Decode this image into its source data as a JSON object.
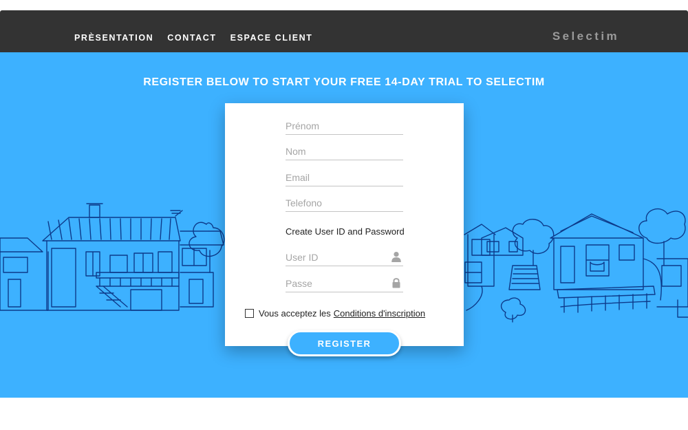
{
  "nav": {
    "links": [
      "PRÈSENTATION",
      "CONTACT",
      "ESPACE CLIENT"
    ],
    "brand": "Selectim"
  },
  "hero": {
    "title": "REGISTER BELOW TO START YOUR FREE 14-DAY TRIAL TO SELECTIM"
  },
  "form": {
    "prenom_placeholder": "Prénom",
    "nom_placeholder": "Nom",
    "email_placeholder": "Email",
    "telefono_placeholder": "Telefono",
    "create_label": "Create User ID and Password",
    "userid_placeholder": "User ID",
    "passe_placeholder": "Passe",
    "terms_text": "Vous acceptez les",
    "terms_link": "Conditions d'inscription",
    "register_label": "REGISTER"
  },
  "colors": {
    "navbar": "#333333",
    "hero_background": "#3db1ff",
    "sketch_lines": "#0d3a8a"
  },
  "icons": [
    "user-icon",
    "lock-icon"
  ]
}
